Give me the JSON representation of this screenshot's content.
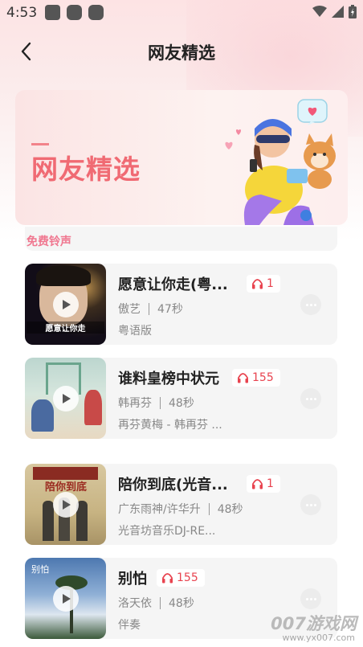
{
  "status": {
    "time": "4:53"
  },
  "header": {
    "title": "网友精选"
  },
  "banner": {
    "title": "网友精选"
  },
  "peek_tag": "免费铃声",
  "songs": [
    {
      "title": "愿意让你走(粤...",
      "plays": "1",
      "artist": "傲艺",
      "duration": "47秒",
      "album": "粤语版",
      "cover_text": "愿意让你走"
    },
    {
      "title": "谁料皇榜中状元",
      "plays": "155",
      "artist": "韩再芬",
      "duration": "48秒",
      "album": "再芬黄梅 - 韩再芬 ..."
    },
    {
      "title": "陪你到底(光音...",
      "plays": "1",
      "artist": "广东雨神/许华升",
      "duration": "48秒",
      "album": "光音坊音乐DJ-RE...",
      "cover_text": "陪你到底"
    },
    {
      "title": "别怕",
      "plays": "155",
      "artist": "洛天依",
      "duration": "48秒",
      "album": "伴奏",
      "cover_text": "别怕"
    }
  ],
  "watermark": {
    "main": "007游戏网",
    "sub": "www.yx007.com"
  },
  "colors": {
    "accent": "#e8434f",
    "banner_title": "#f06a73"
  }
}
